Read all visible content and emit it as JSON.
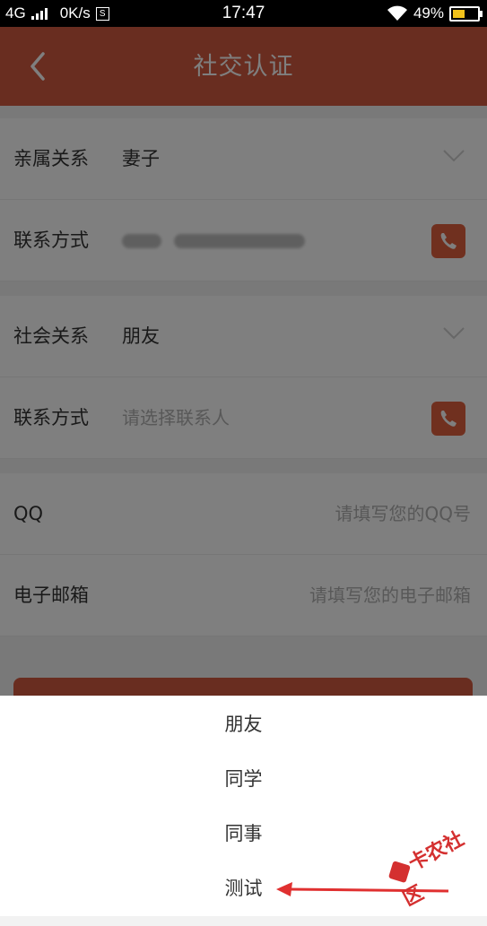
{
  "status_bar": {
    "network": "4G",
    "speed": "0K/s",
    "sim_badge": "S",
    "time": "17:47",
    "battery": "49%"
  },
  "header": {
    "title": "社交认证",
    "back_icon": "chevron-left-icon"
  },
  "form": {
    "relation1": {
      "label": "亲属关系",
      "value": "妻子"
    },
    "contact1": {
      "label": "联系方式"
    },
    "relation2": {
      "label": "社会关系",
      "value": "朋友"
    },
    "contact2": {
      "label": "联系方式",
      "placeholder": "请选择联系人"
    },
    "qq": {
      "label": "QQ",
      "placeholder": "请填写您的QQ号"
    },
    "email": {
      "label": "电子邮箱",
      "placeholder": "请填写您的电子邮箱"
    }
  },
  "picker": {
    "options": [
      "朋友",
      "同学",
      "同事",
      "测试"
    ]
  },
  "watermark": {
    "text": "卡农社区"
  },
  "colors": {
    "brand": "#d35a40",
    "annotation_arrow": "#e03030"
  }
}
